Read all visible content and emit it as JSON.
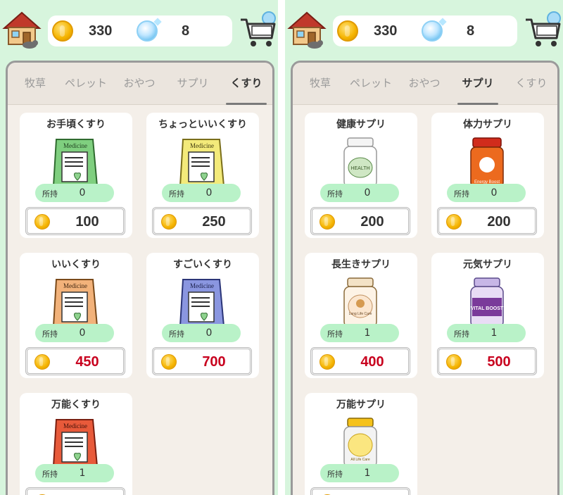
{
  "colors": {
    "background": "#d7f5dd",
    "price_normal": "#333333",
    "price_red": "#c8001e",
    "owned_pill": "#b9f2c8",
    "panel": "#f4efe9"
  },
  "left": {
    "header": {
      "coins": "330",
      "gems": "8",
      "home_icon": "house-icon",
      "shop_icon": "shopping-cart-icon"
    },
    "tabs": [
      {
        "label": "牧草",
        "active": false
      },
      {
        "label": "ペレット",
        "active": false
      },
      {
        "label": "おやつ",
        "active": false
      },
      {
        "label": "サプリ",
        "active": false
      },
      {
        "label": "くすり",
        "active": true
      }
    ],
    "items": [
      {
        "name": "お手頃くすり",
        "owned_label": "所持",
        "owned": "0",
        "price": "100",
        "price_color": "normal",
        "image": "green-medicine-bag",
        "image_text": "Medicine"
      },
      {
        "name": "ちょっといいくすり",
        "owned_label": "所持",
        "owned": "0",
        "price": "250",
        "price_color": "normal",
        "image": "yellow-medicine-bag",
        "image_text": "Medicine"
      },
      {
        "name": "いいくすり",
        "owned_label": "所持",
        "owned": "0",
        "price": "450",
        "price_color": "red",
        "image": "orange-medicine-bag",
        "image_text": "Medicine"
      },
      {
        "name": "すごいくすり",
        "owned_label": "所持",
        "owned": "0",
        "price": "700",
        "price_color": "red",
        "image": "blue-medicine-bag",
        "image_text": "Medicine"
      },
      {
        "name": "万能くすり",
        "owned_label": "所持",
        "owned": "1",
        "price": "",
        "price_color": "red",
        "image": "red-medicine-bag",
        "image_text": "Medicine"
      }
    ]
  },
  "right": {
    "header": {
      "coins": "330",
      "gems": "8",
      "home_icon": "house-icon",
      "shop_icon": "shopping-cart-icon"
    },
    "tabs": [
      {
        "label": "牧草",
        "active": false
      },
      {
        "label": "ペレット",
        "active": false
      },
      {
        "label": "おやつ",
        "active": false
      },
      {
        "label": "サプリ",
        "active": true
      },
      {
        "label": "くすり",
        "active": false
      }
    ],
    "items": [
      {
        "name": "健康サプリ",
        "owned_label": "所持",
        "owned": "0",
        "price": "200",
        "price_color": "normal",
        "image": "health-supplement-bottle",
        "image_text": "HEALTH"
      },
      {
        "name": "体力サプリ",
        "owned_label": "所持",
        "owned": "0",
        "price": "200",
        "price_color": "normal",
        "image": "energy-supplement-bottle",
        "image_text": "Energy Boost"
      },
      {
        "name": "長生きサプリ",
        "owned_label": "所持",
        "owned": "1",
        "price": "400",
        "price_color": "red",
        "image": "long-life-supplement-bottle",
        "image_text": "Long Life Care"
      },
      {
        "name": "元気サプリ",
        "owned_label": "所持",
        "owned": "1",
        "price": "500",
        "price_color": "red",
        "image": "vital-boost-supplement-bottle",
        "image_text": "VITAL BOOST"
      },
      {
        "name": "万能サプリ",
        "owned_label": "所持",
        "owned": "1",
        "price": "",
        "price_color": "red",
        "image": "all-round-supplement-bottle",
        "image_text": "All Life Care"
      }
    ]
  }
}
